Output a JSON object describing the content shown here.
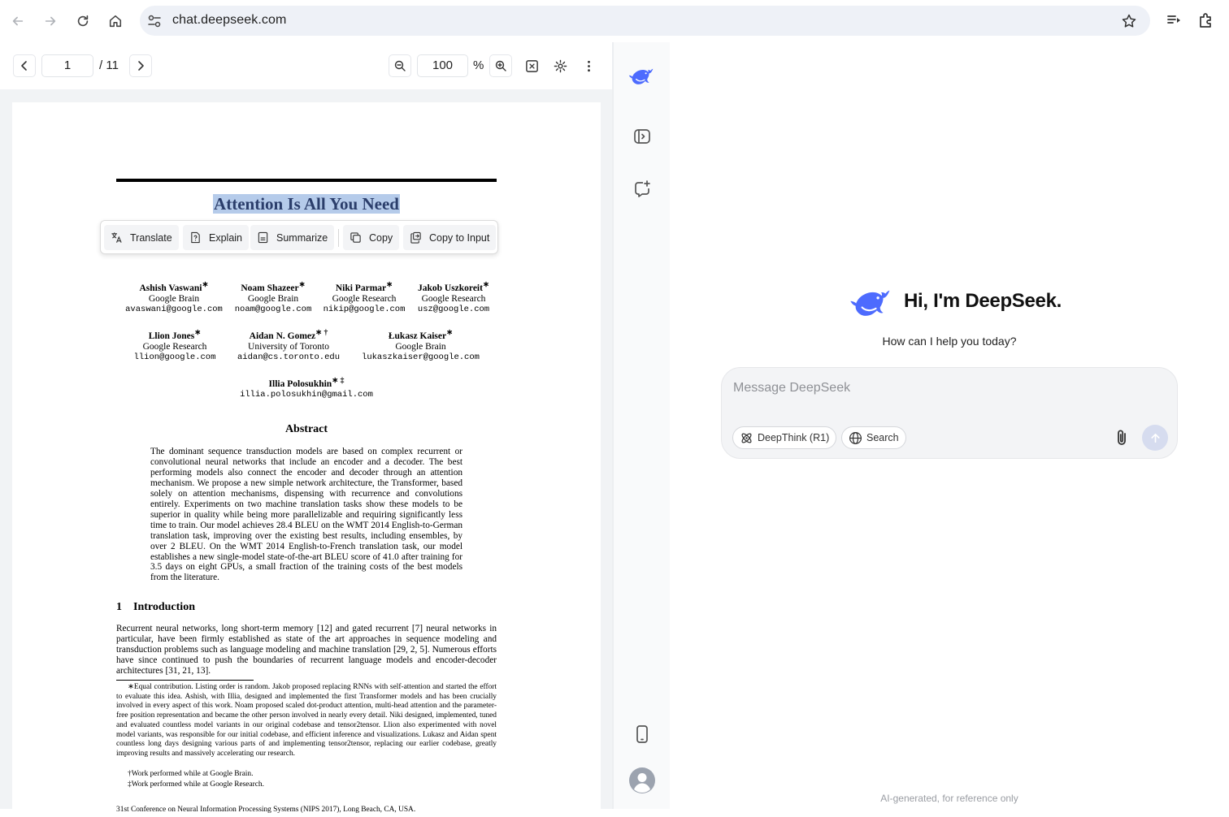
{
  "browser": {
    "url": "chat.deepseek.com"
  },
  "pdf": {
    "page_current": "1",
    "page_total": "/ 11",
    "zoom": "100",
    "zoom_unit": "%",
    "paper_title": "Attention Is All You Need",
    "selection_menu": {
      "translate": "Translate",
      "explain": "Explain",
      "summarize": "Summarize",
      "copy": "Copy",
      "copy_to_input": "Copy to Input"
    },
    "authors": [
      {
        "name": "Ashish Vaswani",
        "mark": "∗",
        "affil": "Google Brain",
        "email": "avaswani@google.com"
      },
      {
        "name": "Noam Shazeer",
        "mark": "∗",
        "affil": "Google Brain",
        "email": "noam@google.com"
      },
      {
        "name": "Niki Parmar",
        "mark": "∗",
        "affil": "Google Research",
        "email": "nikip@google.com"
      },
      {
        "name": "Jakob Uszkoreit",
        "mark": "∗",
        "affil": "Google Research",
        "email": "usz@google.com"
      },
      {
        "name": "Llion Jones",
        "mark": "∗",
        "affil": "Google Research",
        "email": "llion@google.com"
      },
      {
        "name": "Aidan N. Gomez",
        "mark": "∗ †",
        "affil": "University of Toronto",
        "email": "aidan@cs.toronto.edu"
      },
      {
        "name": "Łukasz Kaiser",
        "mark": "∗",
        "affil": "Google Brain",
        "email": "lukaszkaiser@google.com"
      },
      {
        "name": "Illia Polosukhin",
        "mark": "∗ ‡",
        "affil": "",
        "email": "illia.polosukhin@gmail.com"
      }
    ],
    "abstract_title": "Abstract",
    "abstract": "The dominant sequence transduction models are based on complex recurrent or convolutional neural networks that include an encoder and a decoder. The best performing models also connect the encoder and decoder through an attention mechanism. We propose a new simple network architecture, the Transformer, based solely on attention mechanisms, dispensing with recurrence and convolutions entirely. Experiments on two machine translation tasks show these models to be superior in quality while being more parallelizable and requiring significantly less time to train. Our model achieves 28.4 BLEU on the WMT 2014 English-to-German translation task, improving over the existing best results, including ensembles, by over 2 BLEU. On the WMT 2014 English-to-French translation task, our model establishes a new single-model state-of-the-art BLEU score of 41.0 after training for 3.5 days on eight GPUs, a small fraction of the training costs of the best models from the literature.",
    "section_title": "1    Introduction",
    "intro": "Recurrent neural networks, long short-term memory [12] and gated recurrent [7] neural networks in particular, have been firmly established as state of the art approaches in sequence modeling and transduction problems such as language modeling and machine translation [29, 2, 5]. Numerous efforts have since continued to push the boundaries of recurrent language models and encoder-decoder architectures [31, 21, 13].",
    "footnote_main": "∗Equal contribution. Listing order is random. Jakob proposed replacing RNNs with self-attention and started the effort to evaluate this idea. Ashish, with Illia, designed and implemented the first Transformer models and has been crucially involved in every aspect of this work. Noam proposed scaled dot-product attention, multi-head attention and the parameter-free position representation and became the other person involved in nearly every detail. Niki designed, implemented, tuned and evaluated countless model variants in our original codebase and tensor2tensor. Llion also experimented with novel model variants, was responsible for our initial codebase, and efficient inference and visualizations. Lukasz and Aidan spent countless long days designing various parts of and implementing tensor2tensor, replacing our earlier codebase, greatly improving results and massively accelerating our research.",
    "footnote_dagger": "†Work performed while at Google Brain.",
    "footnote_ddagger": "‡Work performed while at Google Research.",
    "page_footer": "31st Conference on Neural Information Processing Systems (NIPS 2017), Long Beach, CA, USA."
  },
  "deepseek": {
    "greeting": "Hi, I'm DeepSeek.",
    "subtitle": "How can I help you today?",
    "input_placeholder": "Message DeepSeek",
    "deepthink_label": "DeepThink (R1)",
    "search_label": "Search",
    "disclaimer": "AI-generated, for reference only"
  },
  "colors": {
    "brand": "#4d6bfe",
    "selection": "#b5cbea"
  },
  "icons": [
    "back-arrow-icon",
    "forward-arrow-icon",
    "reload-icon",
    "home-icon",
    "site-settings-icon",
    "star-icon",
    "reading-list-icon",
    "extensions-icon",
    "deepseek-logo-icon",
    "sidebar-toggle-icon",
    "new-chat-icon",
    "mobile-app-icon",
    "avatar-icon",
    "paperclip-icon",
    "send-arrow-icon",
    "atom-icon",
    "globe-icon"
  ]
}
